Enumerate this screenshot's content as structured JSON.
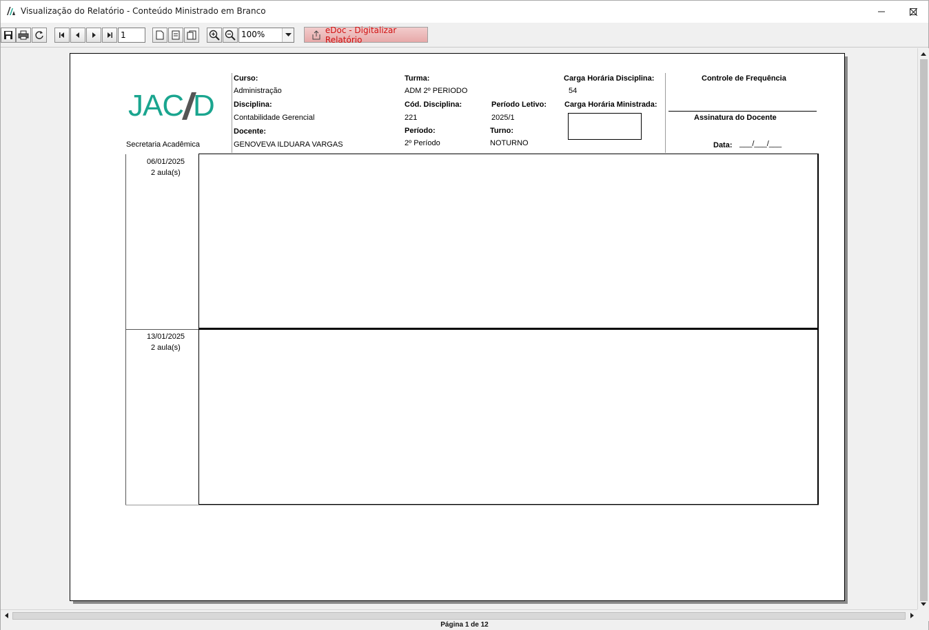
{
  "window": {
    "title": "Visualização do Relatório - Conteúdo Ministrado em Branco"
  },
  "toolbar": {
    "page_number": "1",
    "zoom": "100%",
    "edoc_label": "eDoc - Digitalizar Relatório"
  },
  "report": {
    "logo_text": "JACAD",
    "secretaria": "Secretaria Acadêmica",
    "curso_label": "Curso:",
    "curso_value": "Administração",
    "disciplina_label": "Disciplina:",
    "disciplina_value": "Contabilidade Gerencial",
    "docente_label": "Docente:",
    "docente_value": "GENOVEVA ILDUARA VARGAS",
    "turma_label": "Turma:",
    "turma_value": "ADM 2º PERIODO",
    "cod_disciplina_label": "Cód. Disciplina:",
    "cod_disciplina_value": "221",
    "periodo_label": "Período:",
    "periodo_value": "2º Período",
    "periodo_letivo_label": "Período Letivo:",
    "periodo_letivo_value": "2025/1",
    "turno_label": "Turno:",
    "turno_value": "NOTURNO",
    "carga_disciplina_label": "Carga Horária Disciplina:",
    "carga_disciplina_value": "54",
    "carga_ministrada_label": "Carga Horária Ministrada:",
    "controle_label": "Controle de Frequência",
    "assinatura_label": "Assinatura do Docente",
    "data_label": "Data:",
    "data_value": "___/___/___",
    "entries": [
      {
        "date": "06/01/2025",
        "aulas": "2 aula(s)"
      },
      {
        "date": "13/01/2025",
        "aulas": "2 aula(s)"
      }
    ]
  },
  "status": {
    "page_info": "Página 1 de 12"
  },
  "colors": {
    "logo_teal": "#1aa58f",
    "logo_gray": "#555555",
    "edoc_text": "#d01010"
  }
}
